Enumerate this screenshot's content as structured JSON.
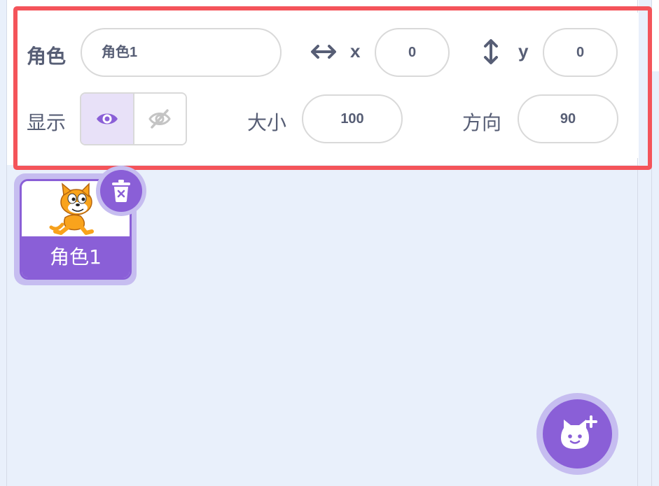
{
  "sprite_info": {
    "name_label": "角色",
    "name_value": "角色1",
    "x_label": "x",
    "x_value": "0",
    "y_label": "y",
    "y_value": "0",
    "show_label": "显示",
    "size_label": "大小",
    "size_value": "100",
    "direction_label": "方向",
    "direction_value": "90",
    "visible": true
  },
  "sprites": [
    {
      "name": "角色1",
      "selected": true
    }
  ],
  "icons": {
    "x_axis": "horizontal-arrows-icon",
    "y_axis": "vertical-arrows-icon",
    "show": "eye-icon",
    "hide": "eye-slash-icon",
    "delete": "trash-icon",
    "add_sprite": "cat-plus-icon"
  },
  "colors": {
    "accent": "#8a5fd7",
    "accent_light": "#c6bdf0",
    "highlight": "#f4545a",
    "text": "#575e75",
    "background": "#e9f0fb"
  }
}
